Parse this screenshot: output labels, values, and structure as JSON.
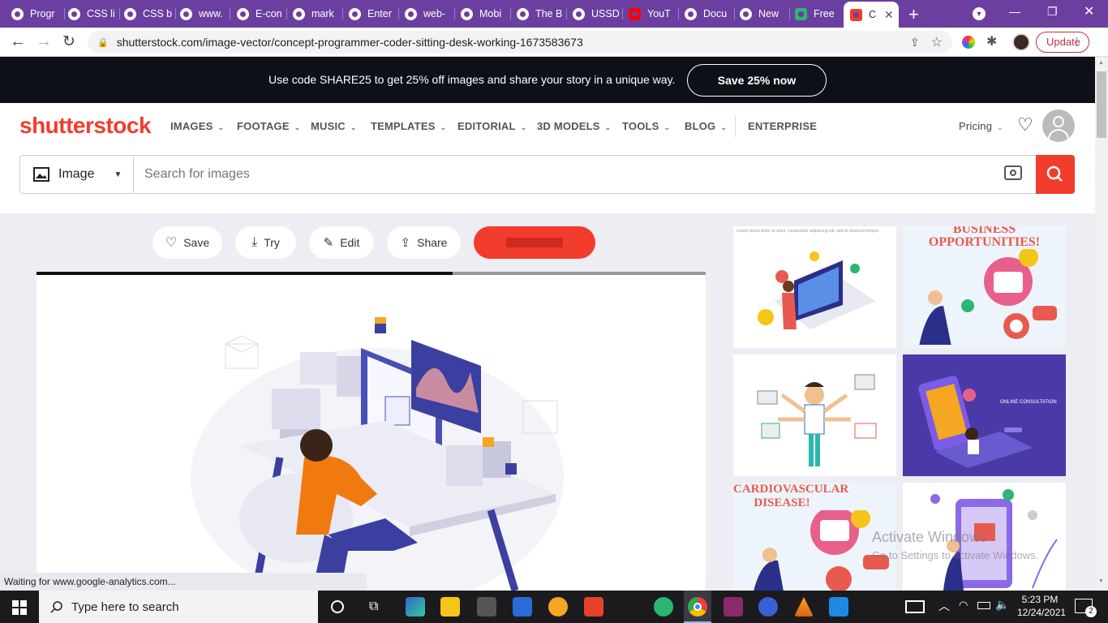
{
  "browser": {
    "tabs": [
      {
        "title": "Progr"
      },
      {
        "title": "CSS li"
      },
      {
        "title": "CSS b"
      },
      {
        "title": "www."
      },
      {
        "title": "E-con"
      },
      {
        "title": "mark"
      },
      {
        "title": "Enter"
      },
      {
        "title": "web-"
      },
      {
        "title": "Mobi"
      },
      {
        "title": "The B"
      },
      {
        "title": "USSD"
      },
      {
        "title": "YouT"
      },
      {
        "title": "Docu"
      },
      {
        "title": "New"
      },
      {
        "title": "Free"
      },
      {
        "title": "C"
      }
    ],
    "url": "shutterstock.com/image-vector/concept-programmer-coder-sitting-desk-working-1673583673",
    "update_label": "Update"
  },
  "promo": {
    "text": "Use code SHARE25 to get 25% off images and share your story in a unique way.",
    "button": "Save 25% now"
  },
  "header": {
    "logo": "shutterstock",
    "nav": [
      {
        "label": "IMAGES"
      },
      {
        "label": "FOOTAGE"
      },
      {
        "label": "MUSIC"
      },
      {
        "label": "TEMPLATES"
      },
      {
        "label": "EDITORIAL"
      },
      {
        "label": "3D MODELS"
      },
      {
        "label": "TOOLS"
      },
      {
        "label": "BLOG"
      },
      {
        "label": "ENTERPRISE"
      }
    ],
    "pricing": "Pricing"
  },
  "search": {
    "type_label": "Image",
    "placeholder": "Search for images"
  },
  "actions": {
    "save": "Save",
    "try": "Try",
    "edit": "Edit",
    "share": "Share"
  },
  "thumbnails": [
    {
      "caption": "Lorem ipsum dolor sit amet, consectetur adipiscing elit, sed do eiusmod tempor"
    },
    {
      "caption": "BUSINESS OPPORTUNITIES!"
    },
    {
      "caption": ""
    },
    {
      "caption": "ONLINE CONSULTATION"
    },
    {
      "caption": "CARDIOVASCULAR DISEASE!"
    },
    {
      "caption": ""
    }
  ],
  "watermark": {
    "line1": "Activate Windows",
    "line2": "Go to Settings to activate Windows."
  },
  "status": "Waiting for www.google-analytics.com...",
  "taskbar": {
    "search_placeholder": "Type here to search",
    "time": "5:23 PM",
    "date": "12/24/2021",
    "notifications": "2"
  },
  "colors": {
    "chrome_frame": "#6a3fa0",
    "brand_red": "#f23c2c",
    "promo_bg": "#0d1117"
  }
}
